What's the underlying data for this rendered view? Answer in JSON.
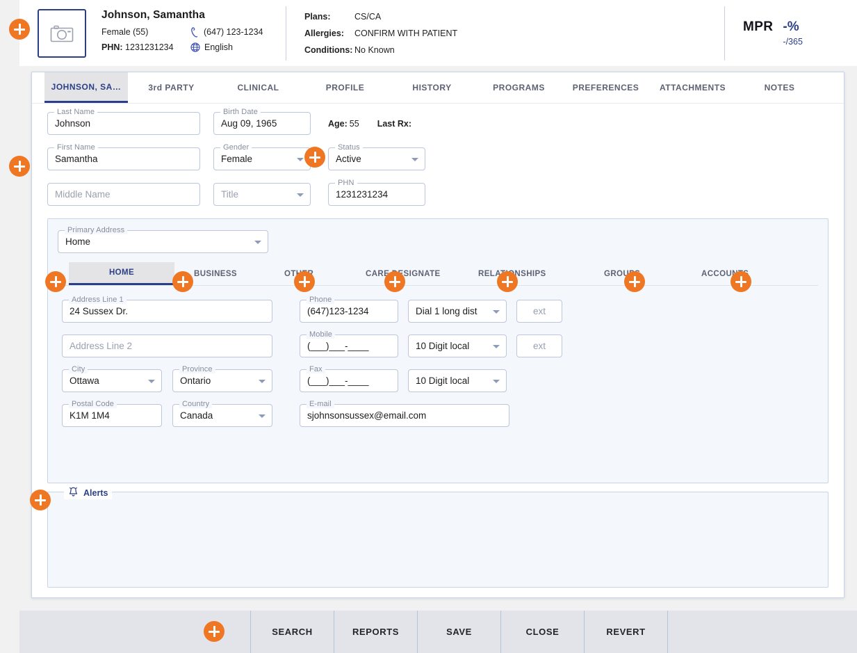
{
  "header": {
    "photo_icon": "camera-icon",
    "patient_name": "Johnson, Samantha",
    "gender_age": "Female (55)",
    "phn_label": "PHN:",
    "phn_value": "1231231234",
    "phone": "(647) 123-1234",
    "language": "English",
    "phone_icon": "phone-icon",
    "globe_icon": "globe-icon",
    "clinical": [
      {
        "label": "Plans:",
        "value": "CS/CA"
      },
      {
        "label": "Allergies:",
        "value": "CONFIRM WITH PATIENT"
      },
      {
        "label": "Conditions:",
        "value": "No Known"
      }
    ],
    "mpr": {
      "label": "MPR",
      "percent": "-%",
      "fraction": "-/365"
    }
  },
  "tabs": [
    {
      "label": "JOHNSON, SA…",
      "active": true
    },
    {
      "label": "3rd PARTY",
      "active": false
    },
    {
      "label": "CLINICAL",
      "active": false
    },
    {
      "label": "PROFILE",
      "active": false
    },
    {
      "label": "HISTORY",
      "active": false
    },
    {
      "label": "PROGRAMS",
      "active": false
    },
    {
      "label": "PREFERENCES",
      "active": false
    },
    {
      "label": "ATTACHMENTS",
      "active": false
    },
    {
      "label": "NOTES",
      "active": false
    }
  ],
  "demographics": {
    "last_name": {
      "legend": "Last Name",
      "value": "Johnson"
    },
    "birth_date": {
      "legend": "Birth Date",
      "value": "Aug 09, 1965"
    },
    "age_label": "Age:",
    "age_value": "55",
    "last_rx_label": "Last Rx:",
    "last_rx_value": "",
    "first_name": {
      "legend": "First Name",
      "value": "Samantha"
    },
    "gender": {
      "legend": "Gender",
      "value": "Female"
    },
    "status": {
      "legend": "Status",
      "value": "Active"
    },
    "middle_name": {
      "legend": "",
      "placeholder": "Middle Name"
    },
    "title": {
      "legend": "",
      "placeholder": "Title"
    },
    "phn": {
      "legend": "PHN",
      "value": "1231231234"
    }
  },
  "address_panel": {
    "primary_address": {
      "legend": "Primary Address",
      "value": "Home"
    },
    "tabs": [
      {
        "label": "HOME",
        "active": true
      },
      {
        "label": "BUSINESS",
        "active": false
      },
      {
        "label": "OTHER",
        "active": false
      },
      {
        "label": "CARE DESIGNATE",
        "active": false
      },
      {
        "label": "RELATIONSHIPS",
        "active": false
      },
      {
        "label": "GROUPS",
        "active": false
      },
      {
        "label": "ACCOUNTS",
        "active": false
      }
    ],
    "address_line_1": {
      "legend": "Address Line 1",
      "value": "24 Sussex Dr."
    },
    "address_line_2": {
      "legend": "",
      "placeholder": "Address Line 2"
    },
    "city": {
      "legend": "City",
      "value": "Ottawa"
    },
    "province": {
      "legend": "Province",
      "value": "Ontario"
    },
    "postal_code": {
      "legend": "Postal Code",
      "value": "K1M 1M4"
    },
    "country": {
      "legend": "Country",
      "value": "Canada"
    },
    "phone": {
      "legend": "Phone",
      "value": "(647)123-1234",
      "dial_type": "Dial 1 long dist",
      "ext_placeholder": "ext"
    },
    "mobile": {
      "legend": "Mobile",
      "value": "(___)___-____",
      "dial_type": "10 Digit local",
      "ext_placeholder": "ext"
    },
    "fax": {
      "legend": "Fax",
      "value": "(___)___-____",
      "dial_type": "10 Digit local"
    },
    "email": {
      "legend": "E-mail",
      "value": "sjohnsonsussex@email.com"
    }
  },
  "alerts": {
    "label": "Alerts",
    "icon": "bell-icon",
    "content": ""
  },
  "toolbar": {
    "buttons": [
      {
        "label": "SEARCH"
      },
      {
        "label": "REPORTS"
      },
      {
        "label": "SAVE"
      },
      {
        "label": "CLOSE"
      },
      {
        "label": "REVERT"
      }
    ]
  },
  "colors": {
    "accent_orange": "#ef7622",
    "brand_navy": "#2b3f87",
    "panel_tint": "#f4f7fc",
    "toolbar_gray": "#e3e4e9"
  }
}
